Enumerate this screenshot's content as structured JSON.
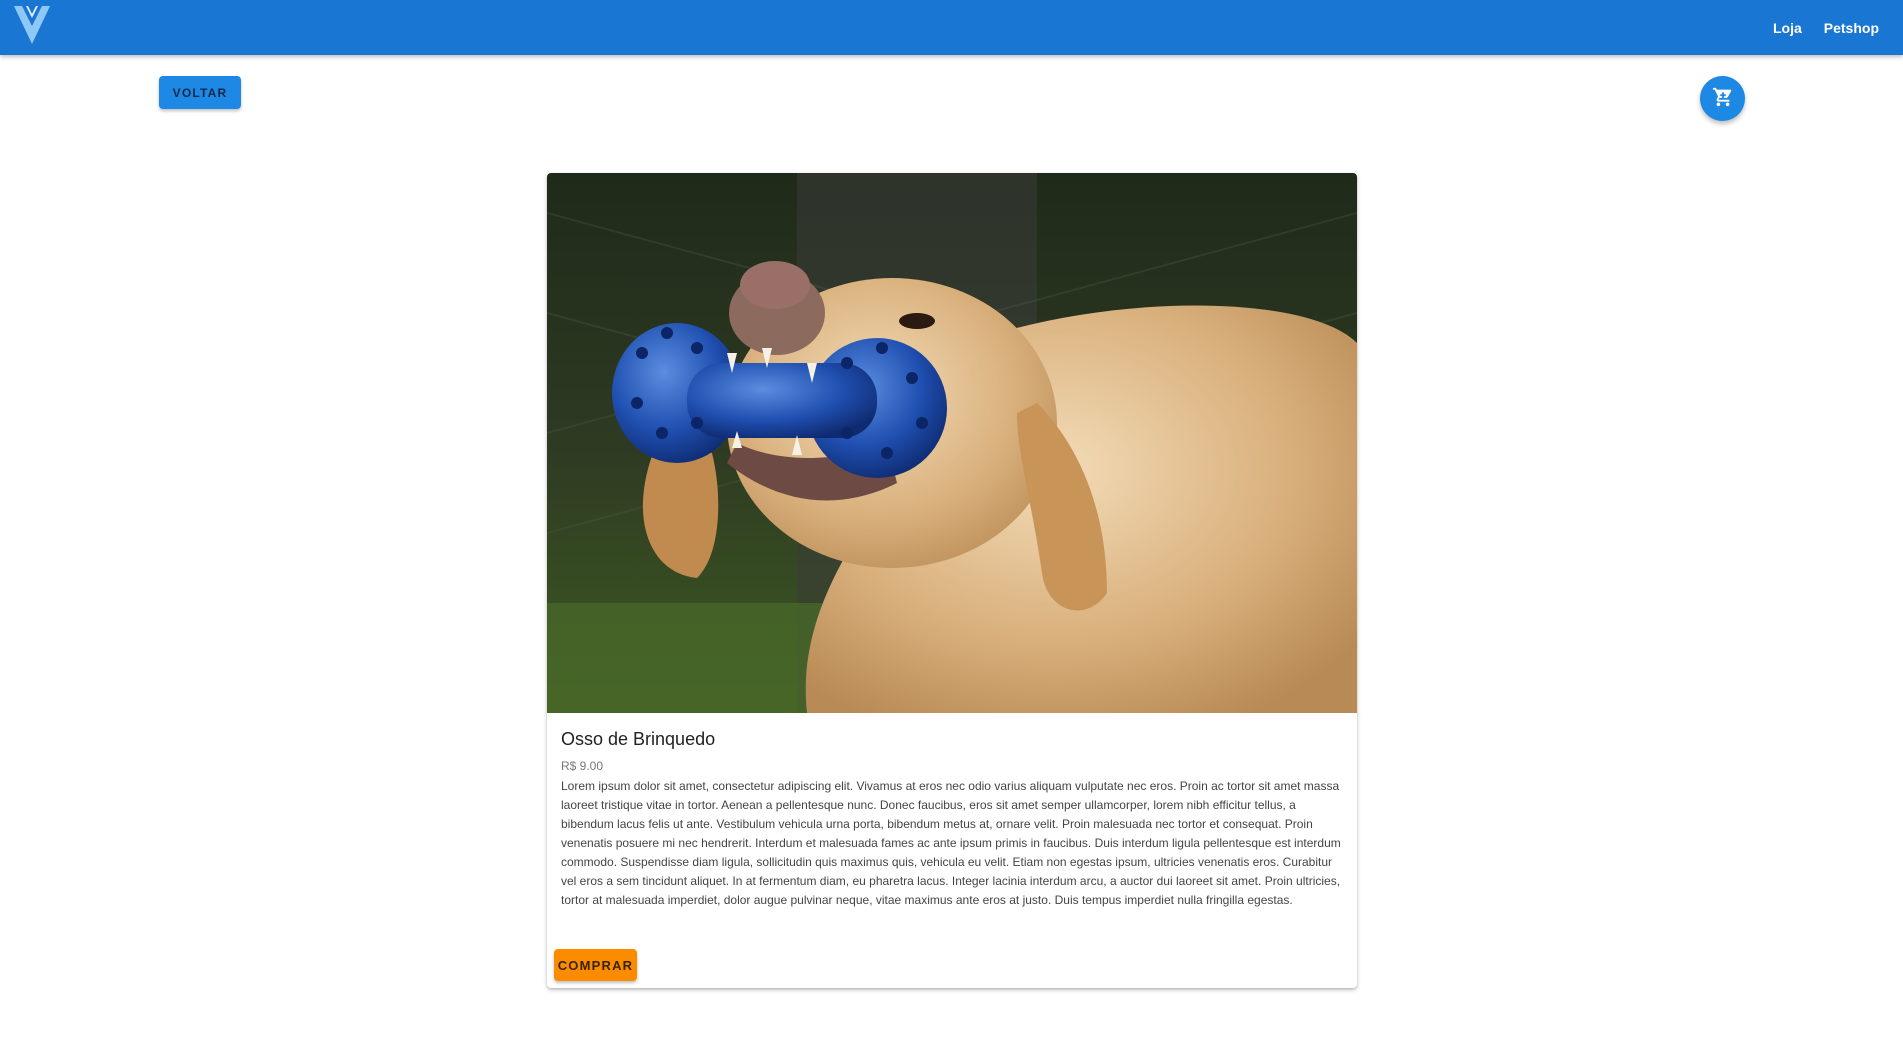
{
  "header": {
    "logo_icon": "vue-logo-icon",
    "nav": [
      {
        "label": "Loja"
      },
      {
        "label": "Petshop"
      }
    ],
    "color": "#1976d2"
  },
  "toolbar": {
    "back_label": "VOLTAR",
    "cart_icon": "cart-icon",
    "accent_color": "#1e88e5"
  },
  "product": {
    "image_icon": "dog-with-toy-bone-photo",
    "name": "Osso de Brinquedo",
    "price": "R$ 9.00",
    "description": "Lorem ipsum dolor sit amet, consectetur adipiscing elit. Vivamus at eros nec odio varius aliquam vulputate nec eros. Proin ac tortor sit amet massa laoreet tristique vitae in tortor. Aenean a pellentesque nunc. Donec faucibus, eros sit amet semper ullamcorper, lorem nibh efficitur tellus, a bibendum lacus felis ut ante. Vestibulum vehicula urna porta, bibendum metus at, ornare velit. Proin malesuada nec tortor et consequat. Proin venenatis posuere mi nec hendrerit. Interdum et malesuada fames ac ante ipsum primis in faucibus. Duis interdum ligula pellentesque est interdum commodo. Suspendisse diam ligula, sollicitudin quis maximus quis, vehicula eu velit. Etiam non egestas ipsum, ultricies venenatis eros. Curabitur vel eros a sem tincidunt aliquet. In at fermentum diam, eu pharetra lacus. Integer lacinia interdum arcu, a auctor dui laoreet sit amet. Proin ultricies, tortor at malesuada imperdiet, dolor augue pulvinar neque, vitae maximus ante eros at justo. Duis tempus imperdiet nulla fringilla egestas.",
    "buy_label": "COMPRAR",
    "buy_color": "#fb8c00"
  }
}
